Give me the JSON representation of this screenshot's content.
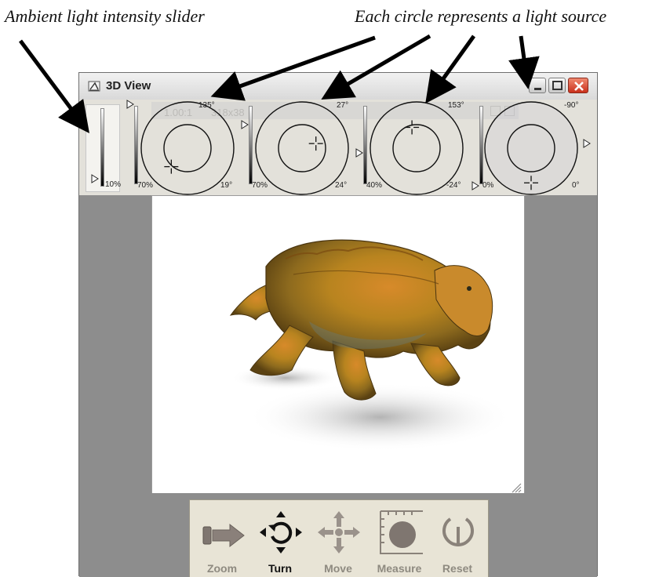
{
  "annotations": {
    "ambient": "Ambient light intensity slider",
    "lights": "Each circle represents a light source"
  },
  "window": {
    "title": "3D View",
    "icon": "3d-view-icon",
    "controls": [
      "minimize-icon",
      "maximize-icon",
      "close-icon"
    ]
  },
  "ghost_toolbar": {
    "zoom_ratio": "1.00:1",
    "size": "318x38"
  },
  "ambient_light": {
    "intensity_label": "10%",
    "intensity": 0.1
  },
  "lights": [
    {
      "top_angle": "135°",
      "bottom_angle": "19°",
      "intensity_label": "70%",
      "intensity": 0.7,
      "crosshair": [
        -0.35,
        0.4
      ]
    },
    {
      "top_angle": "27°",
      "bottom_angle": "24°",
      "intensity_label": "70%",
      "intensity": 0.7,
      "crosshair": [
        0.3,
        -0.1
      ]
    },
    {
      "top_angle": "153°",
      "bottom_angle": "-24°",
      "intensity_label": "40%",
      "intensity": 0.4,
      "crosshair": [
        -0.1,
        -0.45
      ]
    },
    {
      "top_angle": "-90°",
      "bottom_angle": "0°",
      "intensity_label": "0%",
      "intensity": 0.0,
      "crosshair": [
        0,
        0.75
      ]
    }
  ],
  "toolbar": {
    "tools": [
      {
        "label": "Zoom",
        "icon": "zoom-slider-icon",
        "active": false
      },
      {
        "label": "Turn",
        "icon": "rotate-arrows-icon",
        "active": true
      },
      {
        "label": "Move",
        "icon": "move-arrows-icon",
        "active": false
      },
      {
        "label": "Measure",
        "icon": "measure-ruler-icon",
        "active": false
      },
      {
        "label": "Reset",
        "icon": "power-reset-icon",
        "active": false
      }
    ]
  },
  "colors": {
    "window_frame": "#e7e5df",
    "viewport_bg": "#8d8d8d",
    "canvas_bg": "#ffffff",
    "close_button": "#d9432b",
    "toolbar_bg": "#e8e4d6",
    "tool_icon": "#8a7f78"
  }
}
